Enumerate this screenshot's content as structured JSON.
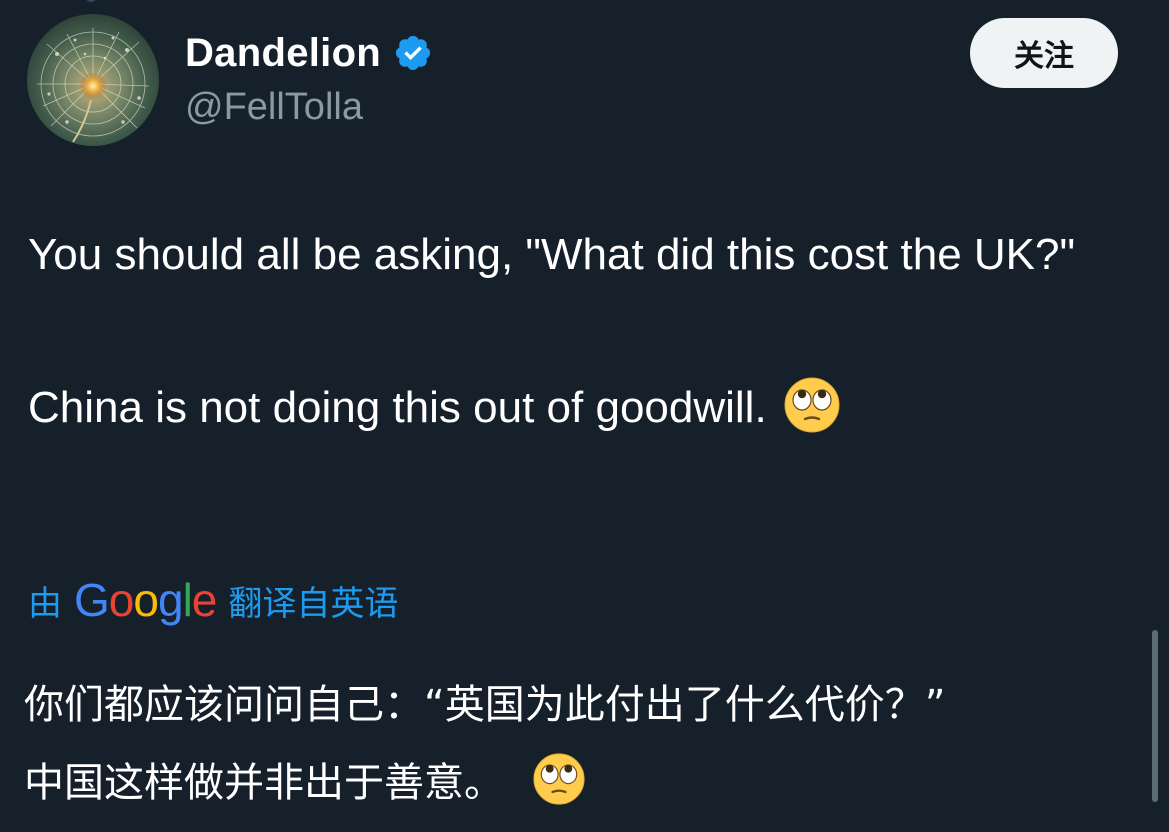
{
  "author": {
    "display_name": "Dandelion",
    "handle": "@FellTolla",
    "verified": true,
    "avatar_icon": "dandelion-avatar",
    "verified_icon": "verified-badge-icon"
  },
  "actions": {
    "follow_label": "关注"
  },
  "tweet": {
    "paragraphs": [
      "You should all be asking, \"What did this cost the UK?\"",
      "China is not doing this out of goodwill."
    ],
    "emoji": "face-with-rolling-eyes"
  },
  "translation": {
    "prefix": "由",
    "google": [
      "G",
      "o",
      "o",
      "g",
      "l",
      "e"
    ],
    "suffix": "翻译自英语",
    "lines": [
      "你们都应该问问自己：“英国为此付出了什么代价？”",
      "中国这样做并非出于善意。"
    ]
  },
  "colors": {
    "background": "#15202b",
    "accent": "#1d9bf0",
    "secondary_text": "#8b98a5",
    "follow_button_bg": "#eff3f4"
  }
}
